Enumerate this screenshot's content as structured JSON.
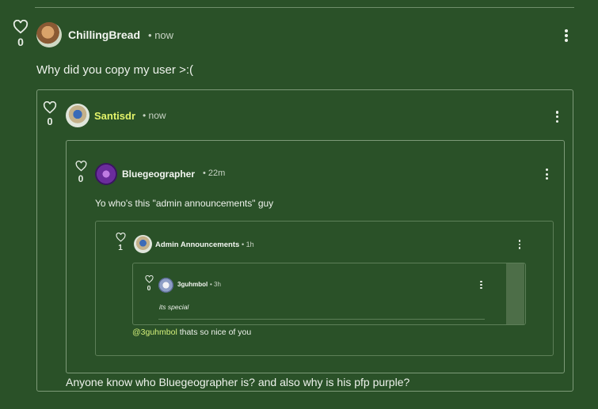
{
  "thread": {
    "top_comment": {
      "author": "ChillingBread",
      "time": "now",
      "likes": "0",
      "text": "Why did you copy my user >:("
    },
    "quoted": {
      "author": "Santisdr",
      "time": "now",
      "likes": "0",
      "text": "Anyone know who Bluegeographer is? and also why is his pfp purple?",
      "quoted": {
        "author": "Bluegeographer",
        "time": "22m",
        "likes": "0",
        "text": "Yo who's this \"admin announcements\" guy",
        "quoted": {
          "author": "Admin Announcements",
          "time": "1h",
          "likes": "1",
          "reply_mention": "@3guhmbol",
          "reply_text": " thats so nice of you",
          "quoted": {
            "author": "3guhmbol",
            "time": "3h",
            "likes": "0",
            "text": "its special"
          }
        }
      }
    },
    "separator": "•"
  },
  "colors": {
    "background": "#2a5128",
    "username_highlight": "#e3f36a",
    "mention": "#d4f07a"
  },
  "icons": [
    "heart-icon",
    "more-options-icon"
  ]
}
